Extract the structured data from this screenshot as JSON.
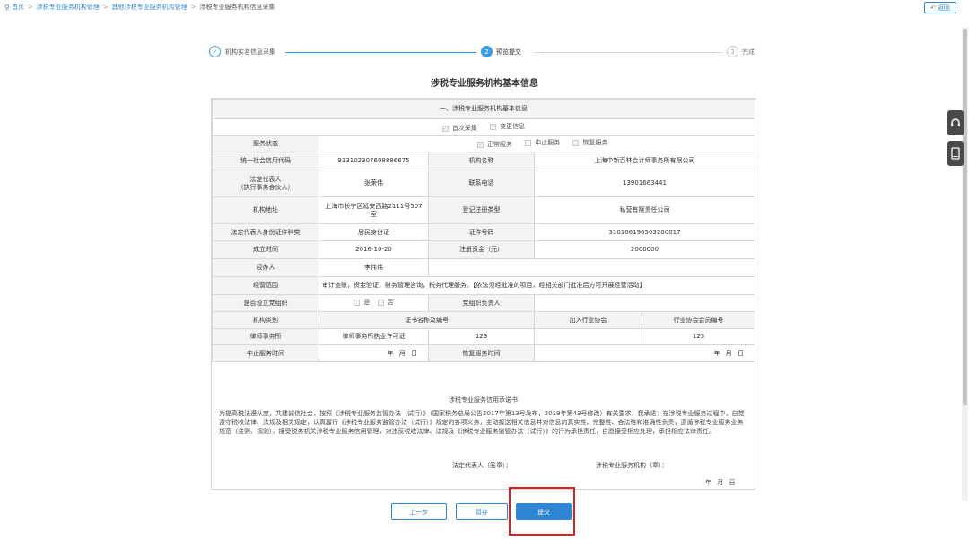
{
  "breadcrumb": {
    "items": [
      "首页",
      "涉税专业服务机构管理",
      "其他涉税专业服务机构管理",
      "涉税专业服务机构信息采集"
    ]
  },
  "back_button": {
    "label": "返回",
    "icon": "undo-icon"
  },
  "side_tools": [
    {
      "icon": "headset-icon"
    },
    {
      "icon": "tablet-icon"
    }
  ],
  "steps": [
    {
      "label": "机构实名信息采集",
      "marker": "✓",
      "state": "done"
    },
    {
      "label": "预览提交",
      "marker": "2",
      "state": "active"
    },
    {
      "label": "完成",
      "marker": "3",
      "state": "pending"
    }
  ],
  "form": {
    "title": "涉税专业服务机构基本信息",
    "section_title": "一、涉税专业服务机构基本信息",
    "collection_type": {
      "options": [
        "首次采集",
        "变更信息"
      ]
    },
    "service_status": {
      "label": "服务状态",
      "options": [
        "正常服务",
        "中止服务",
        "恢复服务"
      ]
    },
    "credit_code": {
      "label": "统一社会信用代码",
      "value": "913102307608886675"
    },
    "org_name": {
      "label": "机构名称",
      "value": "上海中新百林会计师事务所有限公司"
    },
    "legal_rep": {
      "label_line1": "法定代表人",
      "label_line2": "（执行事务合伙人）",
      "value": "张荣伟"
    },
    "phone": {
      "label": "联系电话",
      "value": "13901663441"
    },
    "address": {
      "label": "机构地址",
      "value_line1": "上海市长宁区延安西路2111号507",
      "value_line2": "室"
    },
    "reg_type": {
      "label": "登记注册类型",
      "value": "私营有限责任公司"
    },
    "id_type": {
      "label": "法定代表人身份证件种类",
      "value": "居民身份证"
    },
    "id_no": {
      "label": "证件号码",
      "value": "310106196503200017"
    },
    "established": {
      "label": "成立时间",
      "value": "2016-10-20"
    },
    "capital": {
      "label": "注册资金（元）",
      "value": "2000000"
    },
    "handler": {
      "label": "经办人",
      "value": "李伟伟"
    },
    "scope": {
      "label": "经营范围",
      "value": "审计查账，资金验证，财务管理咨询，税务代理服务。【依法须经批准的项目，经相关部门批准后方可开展经营活动】"
    },
    "party_org": {
      "label": "是否设立党组织",
      "options": [
        "是",
        "否"
      ],
      "leader_label": "党组织负责人",
      "leader_value": ""
    },
    "headers": {
      "category": "机构类别",
      "cert": "证书名称及编号",
      "association": "加入行业协会",
      "member_no": "行业协会会员编号"
    },
    "cert_row": {
      "category": "律师事务所",
      "cert_name": "律师事务所执业许可证",
      "cert_no": "123",
      "association": "",
      "member_no": "123"
    },
    "suspend_time": {
      "label": "中止服务时间",
      "date": "年  月  日"
    },
    "resume_time": {
      "label": "恢复服务时间",
      "date": "年  月  日"
    }
  },
  "pledge": {
    "title": "涉税专业服务信用承诺书",
    "body": "为提高税法遵从度，共建诚信社会，按照《涉税专业服务监管办法（试行）》（国家税务总局公告2017年第13号发布，2019年第43号修改）有关要求，我承诺：在涉税专业服务过程中，自觉遵守税收法律、法规及相关规定，认真履行《涉税专业服务监管办法（试行）》规定的各项义务，主动报送相关信息并对信息的真实性、完整性、合法性和准确性负责，遵循涉税专业服务业务规范（准则、规则），接受税务机关涉税专业服务信用管理，对违反税收法律、法规及《涉税专业服务监管办法（试行）》的行为承担责任，自愿接受相应处理，承担相应法律责任。",
    "legal_sign": "法定代表人（签章）：",
    "org_sign": "涉税专业服务机构（章）：",
    "date": "年  月  日"
  },
  "buttons": {
    "prev": "上一步",
    "save": "暂存",
    "submit": "提交"
  },
  "colors": {
    "accent": "#2f86d4",
    "done_step": "#3b9ae1",
    "highlight": "#e02020"
  }
}
